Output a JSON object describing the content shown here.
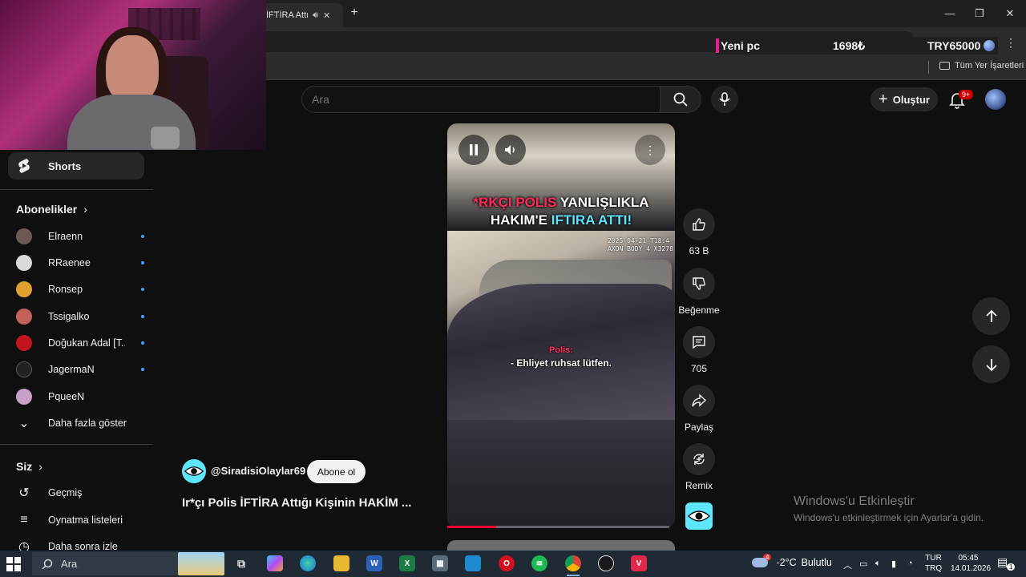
{
  "browser": {
    "tab_title": "İFTİRA Attığı",
    "new_tab": "+",
    "window_controls": {
      "minimize": "—",
      "maximize": "❐",
      "close": "✕"
    },
    "overlay": {
      "label": "Yeni pc",
      "amount": "1698₺",
      "goal": "TRY65000"
    },
    "bookmarks_all": "Tüm Yer İşaretleri"
  },
  "header": {
    "search_placeholder": "Ara",
    "create_label": "Oluştur",
    "notification_badge": "9+"
  },
  "sidebar": {
    "shorts_label": "Shorts",
    "subscriptions_title": "Abonelikler",
    "subscriptions": [
      {
        "name": "Elraenn",
        "color": "#6b5a52"
      },
      {
        "name": "RRaenee",
        "color": "#d9d9d9"
      },
      {
        "name": "Ronsep",
        "color": "#e0a030"
      },
      {
        "name": "Tssigalko",
        "color": "#c4605a"
      },
      {
        "name": "Doğukan Adal [T...",
        "color": "#c0141e"
      },
      {
        "name": "JagermaN",
        "color": "#222222"
      },
      {
        "name": "PqueeN",
        "color": "#c7a0c8"
      }
    ],
    "show_more": "Daha fazla göster",
    "you_title": "Siz",
    "you_items": [
      {
        "label": "Geçmiş",
        "icon": "history-icon"
      },
      {
        "label": "Oynatma listeleri",
        "icon": "playlist-icon"
      },
      {
        "label": "Daha sonra izle",
        "icon": "clock-icon"
      }
    ]
  },
  "video": {
    "caption_red": "*RKÇI POLIS",
    "caption_white_1": "YANLIŞLIKLA",
    "caption_white_2": "HAKIM'E",
    "caption_cyan": "IFTIRA ATTI!",
    "stamp_line_1": "2025-04-21  T18:4",
    "stamp_line_2": "AXON BODY 4 X3278",
    "subtitle_speaker": "Polis:",
    "subtitle_text": "- Ehliyet ruhsat lütfen.",
    "progress": 0.22
  },
  "actions": {
    "likes": "63 B",
    "dislike": "Beğenme",
    "comments": "705",
    "share": "Paylaş",
    "remix": "Remix"
  },
  "channel": {
    "handle": "@SiradisiOlaylar69",
    "subscribe": "Abone ol",
    "title": "Ir*çı Polis İFTİRA Attığı Kişinin HAKİM ..."
  },
  "activation": {
    "title": "Windows'u Etkinleştir",
    "message": "Windows'u etkinleştirmek için Ayarlar'a gidin."
  },
  "taskbar": {
    "search_placeholder": "Ara",
    "weather_temp": "-2°C",
    "weather_desc": "Bulutlu",
    "weather_alert": "4",
    "lang_1": "TUR",
    "lang_2": "TRQ",
    "time": "05:45",
    "date": "14.01.2026",
    "notif_count": "1"
  }
}
